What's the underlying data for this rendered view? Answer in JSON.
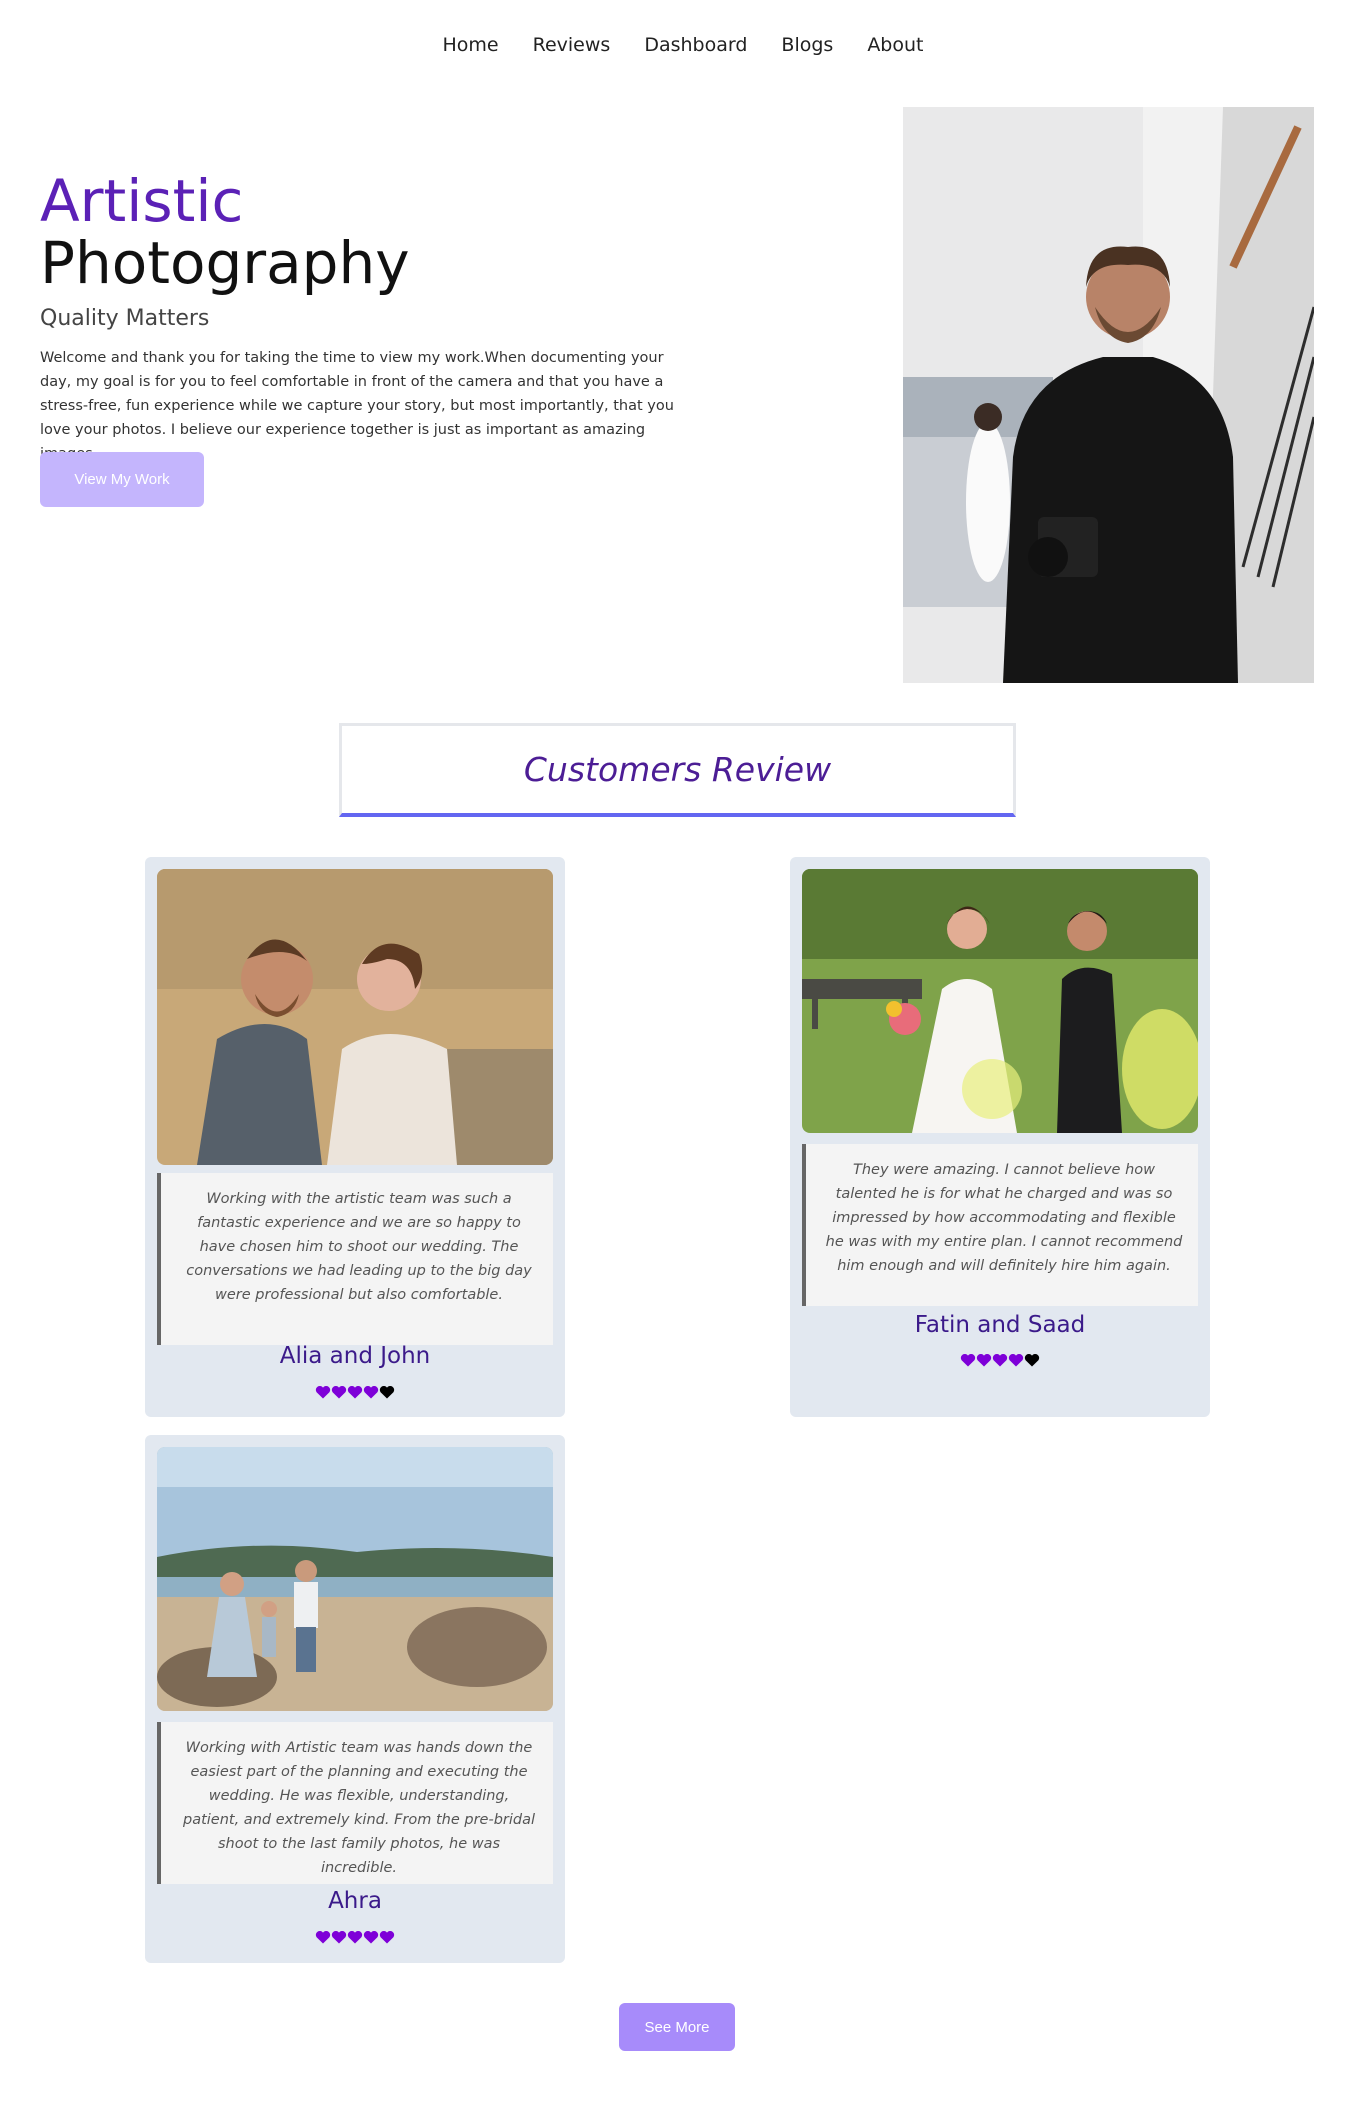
{
  "nav": {
    "items": [
      {
        "label": "Home"
      },
      {
        "label": "Reviews"
      },
      {
        "label": "Dashboard"
      },
      {
        "label": "Blogs"
      },
      {
        "label": "About"
      }
    ]
  },
  "hero": {
    "title_accent": "Artistic",
    "title_main": "Photography",
    "subtitle": "Quality Matters",
    "description": "Welcome and thank you for taking the time to view my work.When documenting your day, my goal is for you to feel comfortable in front of the camera and that you have a stress-free, fun experience while we capture your story, but most importantly, that you love your photos. I believe our experience together is just as important as amazing images.",
    "button_label": "View My Work"
  },
  "reviews": {
    "heading": "Customers Review",
    "items": [
      {
        "quote": "Working with the artistic team was such a fantastic experience and we are so happy to have chosen him to shoot our wedding. The conversations we had leading up to the big day were professional but also comfortable.",
        "name": "Alia and John",
        "rating": 4
      },
      {
        "quote": "They were amazing. I cannot believe how talented he is for what he charged and was so impressed by how accommodating and flexible he was with my entire plan. I cannot recommend him enough and will definitely hire him again.",
        "name": "Fatin and Saad",
        "rating": 4
      },
      {
        "quote": "Working with Artistic team was hands down the easiest part of the planning and executing the wedding. He was flexible, understanding, patient, and extremely kind. From the pre-bridal shoot to the last family photos, he was incredible.",
        "name": "Ahra",
        "rating": 5
      }
    ],
    "see_more_label": "See More"
  },
  "colors": {
    "accent": "#5b21b6",
    "heart_filled": "#7e00d8",
    "heart_empty": "#000000",
    "card_bg": "#e2e8f0",
    "button_light": "#c4b5fd",
    "button": "#a78bfa"
  }
}
